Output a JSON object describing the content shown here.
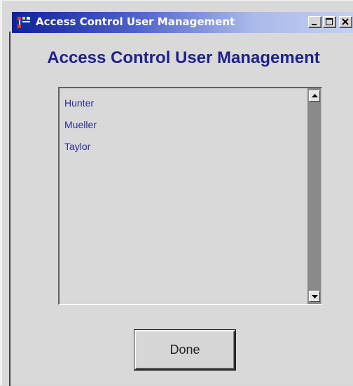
{
  "window": {
    "title": "Access Control User Management",
    "controls": {
      "minimize": "minimize",
      "maximize": "maximize",
      "close": "close"
    }
  },
  "heading": "Access Control User Management",
  "users": {
    "items": [
      "Hunter",
      "Mueller",
      "Taylor"
    ]
  },
  "done_button": {
    "label": "Done"
  },
  "colors": {
    "heading": "#20208e",
    "list_text": "#2b2b9a",
    "titlebar_start": "#10209a",
    "titlebar_end": "#c4d0f2",
    "background": "#d9d9d9"
  },
  "icons": {
    "app": "app-icon",
    "scroll_up": "scroll-up-arrow-icon",
    "scroll_down": "scroll-down-arrow-icon"
  }
}
